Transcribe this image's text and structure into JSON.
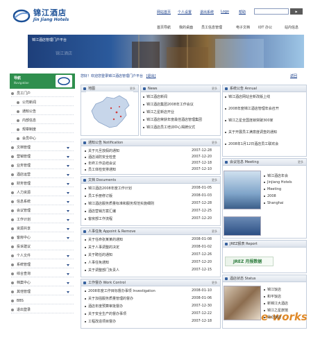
{
  "brand": {
    "name_cn": "锦江酒店",
    "name_en": "Jin Jiang Hotels"
  },
  "header": {
    "top_links": [
      "网站首页",
      "个人设置",
      "退出系统",
      "Logo",
      "帮助"
    ],
    "nav": [
      "首页导航",
      "我的桌面",
      "员工信息管理",
      "电子文档",
      "IDT 办公",
      "站内信息"
    ]
  },
  "banner": {
    "text": "锦江酒店管理门户平台",
    "faded_text": "锦江酒店"
  },
  "left_nav": {
    "title_cn": "导航",
    "title_en": "Navigation",
    "items": [
      {
        "label": "员工门户",
        "sub": false,
        "expand": false
      },
      {
        "label": "公司新闻",
        "sub": true,
        "expand": false
      },
      {
        "label": "通知公告",
        "sub": true,
        "expand": false
      },
      {
        "label": "内部信息",
        "sub": true,
        "expand": false
      },
      {
        "label": "规章制度",
        "sub": true,
        "expand": false
      },
      {
        "label": "会员中心",
        "sub": true,
        "expand": false
      },
      {
        "label": "文档管理",
        "sub": false,
        "expand": true
      },
      {
        "label": "营销管理",
        "sub": false,
        "expand": true
      },
      {
        "label": "业务管理",
        "sub": false,
        "expand": true
      },
      {
        "label": "酒店运营",
        "sub": false,
        "expand": true
      },
      {
        "label": "财务管理",
        "sub": false,
        "expand": true
      },
      {
        "label": "人力资源",
        "sub": false,
        "expand": true
      },
      {
        "label": "信息系统",
        "sub": false,
        "expand": true
      },
      {
        "label": "会议管理",
        "sub": false,
        "expand": true
      },
      {
        "label": "工作计划",
        "sub": false,
        "expand": true
      },
      {
        "label": "资源共享",
        "sub": false,
        "expand": true
      },
      {
        "label": "客房中心",
        "sub": false,
        "expand": true
      },
      {
        "label": "投诉建议",
        "sub": false,
        "expand": false
      },
      {
        "label": "个人文件",
        "sub": false,
        "expand": true
      },
      {
        "label": "系统管理",
        "sub": false,
        "expand": true
      },
      {
        "label": "综合查询",
        "sub": false,
        "expand": true
      },
      {
        "label": "档案中心",
        "sub": false,
        "expand": true
      },
      {
        "label": "其他管理",
        "sub": false,
        "expand": true
      },
      {
        "label": "BBS",
        "sub": false,
        "expand": false
      },
      {
        "label": "退出登录",
        "sub": false,
        "expand": false
      }
    ]
  },
  "breadcrumb": {
    "text": "您好！欢迎您登录锦江酒店管理门户平台",
    "link": "[退出]",
    "right": "返回"
  },
  "panels": {
    "map": {
      "title": "地图",
      "more": "更多"
    },
    "news": {
      "title": "News",
      "more": "更多",
      "items": [
        "锦江酒店新闻",
        "锦江酒店集团2008年工作会议",
        "锦江之星新店开业",
        "锦江酒店荣获年度最佳酒店管理集团",
        "锦江酒店员工培训中心揭牌仪式"
      ]
    },
    "notification": {
      "title": "通知公告 Notification",
      "more": "更多",
      "items": [
        {
          "text": "关于元旦放假的通知",
          "date": "2007-12-28"
        },
        {
          "text": "酒店消防安全检查",
          "date": "2007-12-20"
        },
        {
          "text": "年终工作总结会议",
          "date": "2007-12-18"
        },
        {
          "text": "员工体检安排通知",
          "date": "2007-12-10"
        }
      ]
    },
    "documents": {
      "title": "文档 Documents",
      "more": "更多",
      "items": [
        {
          "text": "锦江酒店2008年度工作计划",
          "date": "2008-01-05"
        },
        {
          "text": "员工手册修订版",
          "date": "2008-01-03"
        },
        {
          "text": "锦江酒店服务质量标准和服务规范实施细则",
          "date": "2007-12-28"
        },
        {
          "text": "酒店营销方案汇编",
          "date": "2007-12-25"
        },
        {
          "text": "客房部工作流程",
          "date": "2007-12-20"
        }
      ]
    },
    "appoint": {
      "title": "人事任免 Appoint & Remove",
      "more": "更多",
      "items": [
        {
          "text": "关于任命张某某的通知",
          "date": "2008-01-08"
        },
        {
          "text": "关于人事调整的决定",
          "date": "2008-01-02"
        },
        {
          "text": "关于聘任的通知",
          "date": "2007-12-26"
        },
        {
          "text": "人事任免通知",
          "date": "2007-12-20"
        },
        {
          "text": "关于调整部门负责人",
          "date": "2007-12-15"
        }
      ]
    },
    "workcontrol": {
      "title": "工作督办 Work Control",
      "more": "更多",
      "items": [
        {
          "text": "2008年度工作目标督办事项 Investigation",
          "date": "2008-01-10"
        },
        {
          "text": "关于加强服务质量管理的督办",
          "date": "2008-01-06"
        },
        {
          "text": "酒店年度预算审批督办",
          "date": "2007-12-30"
        },
        {
          "text": "关于安全生产的督办事项",
          "date": "2007-12-22"
        },
        {
          "text": "工程改造项目督办",
          "date": "2007-12-18"
        }
      ]
    },
    "announce": {
      "title": "系统公告 Annual",
      "items": [
        "锦江酒店网站全新改版上线",
        "2008年度锦江酒店管理年会召开",
        "锦江之星全国连锁突破300家",
        "关于开展员工满意度调查的通知",
        "2008年1月12日酒店员工联欢会"
      ]
    },
    "meeting": {
      "title": "会议信息 Meeting",
      "more": "更多",
      "items": [
        "锦江酒店年会",
        "Jinjiang Hotels",
        "Meeting",
        "2008",
        "Shanghai"
      ]
    },
    "report": {
      "title": "JREZ报表 Report",
      "rez_text": "JREZ 月报数据"
    },
    "status": {
      "title": "酒店状态 Status",
      "items": [
        "锦江饭店",
        "和平饭店",
        "新锦江大酒店",
        "锦江之星旅馆",
        "昆仑饭店"
      ]
    }
  },
  "watermark": "e-works"
}
